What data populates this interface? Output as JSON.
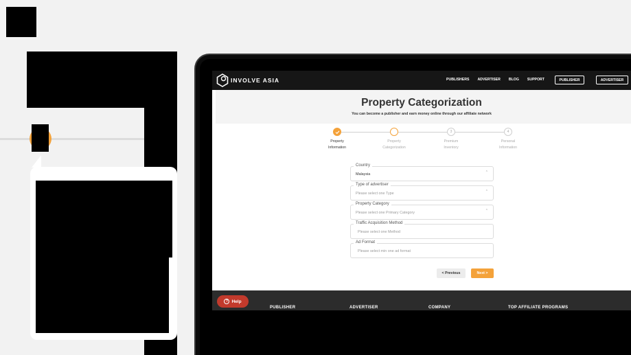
{
  "nav": {
    "brand": "INVOLVE ASIA",
    "links": [
      "PUBLISHERS",
      "ADVERTISER",
      "BLOG",
      "SUPPORT"
    ],
    "publisher_button": "PUBLISHER",
    "advertiser_button": "ADVERTISER"
  },
  "header": {
    "title": "Property Categorization",
    "subtitle": "You can become a publisher and earn money online through our affiliate network"
  },
  "stepper": {
    "steps": [
      {
        "number": "1",
        "line1": "Property",
        "line2": "Information",
        "state": "done"
      },
      {
        "number": "2",
        "line1": "Property",
        "line2": "Categorization",
        "state": "active"
      },
      {
        "number": "3",
        "line1": "Premium",
        "line2": "Inventory",
        "state": "todo"
      },
      {
        "number": "4",
        "line1": "Personal",
        "line2": "Information",
        "state": "todo"
      }
    ]
  },
  "form": {
    "country": {
      "label": "Country",
      "value": "Malaysia"
    },
    "advertiser_type": {
      "label": "Type of advertiser",
      "placeholder": "Please select one Type"
    },
    "property_category": {
      "label": "Property Category",
      "placeholder": "Please select one Primary Category"
    },
    "traffic_method": {
      "label": "Traffic Acquisition Method",
      "placeholder": "Please select one Method"
    },
    "ad_format": {
      "label": "Ad Format",
      "placeholder": "Please select min one ad format"
    }
  },
  "actions": {
    "previous": "< Previous",
    "next": "Next >"
  },
  "footer": {
    "help": "Help",
    "columns": [
      "PUBLISHER",
      "ADVERTISER",
      "COMPANY",
      "TOP AFFILIATE PROGRAMS"
    ]
  },
  "colors": {
    "accent": "#f4a23a",
    "help": "#c23a2c",
    "nav": "#161616",
    "footer": "#2c2c2c"
  }
}
